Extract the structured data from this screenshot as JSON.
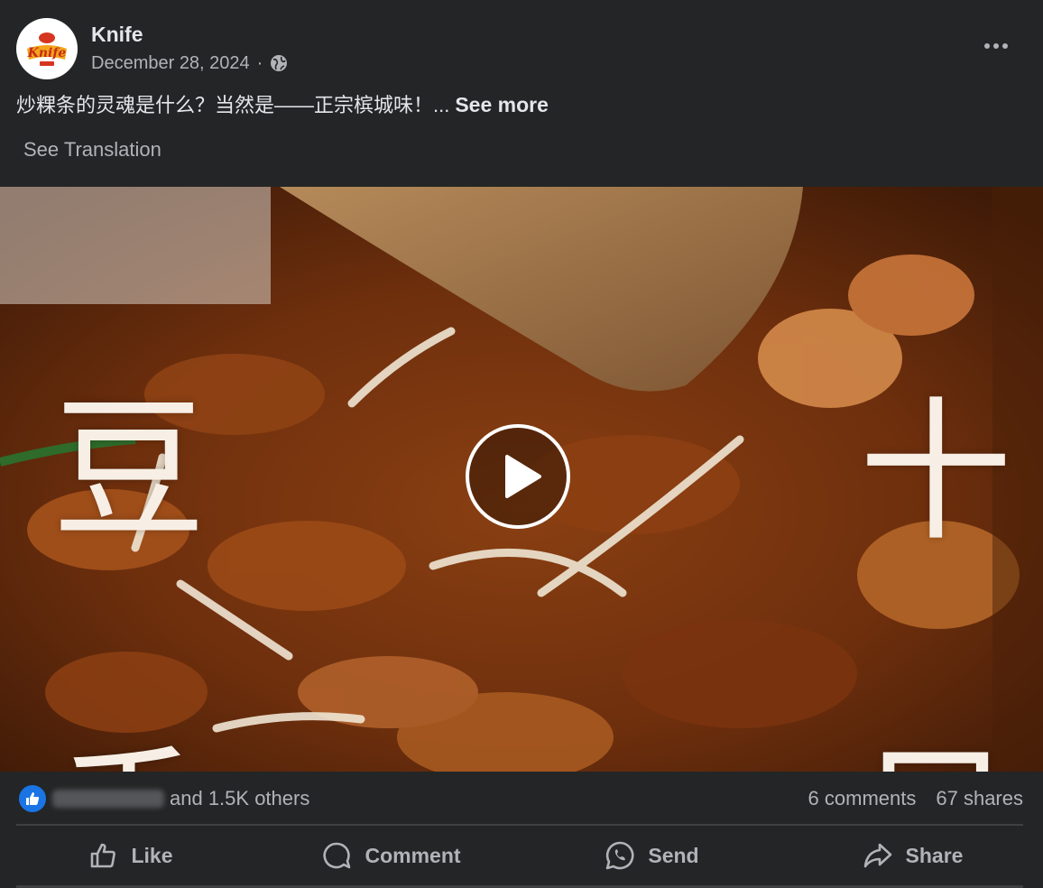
{
  "post": {
    "author": "Knife",
    "date": "December 28, 2024",
    "separator": "·",
    "privacy_icon": "globe-icon",
    "logo_text": "Knife",
    "caption": "炒粿条的灵魂是什么？当然是——正宗槟城味！...",
    "see_more": "See more",
    "see_translation": "See Translation"
  },
  "video": {
    "overlay_chars": [
      "豆",
      "十",
      "香",
      "足"
    ],
    "play_icon": "play-icon"
  },
  "stats": {
    "reaction_icon": "like-icon",
    "reactors_suffix": "and 1.5K others",
    "comments": "6 comments",
    "shares": "67 shares"
  },
  "actions": {
    "like": "Like",
    "comment": "Comment",
    "send": "Send",
    "share": "Share"
  },
  "colors": {
    "background": "#242526",
    "primary_text": "#e4e6eb",
    "secondary_text": "#b0b3b8",
    "like_blue": "#1b74e4",
    "logo_red": "#d6361f"
  }
}
